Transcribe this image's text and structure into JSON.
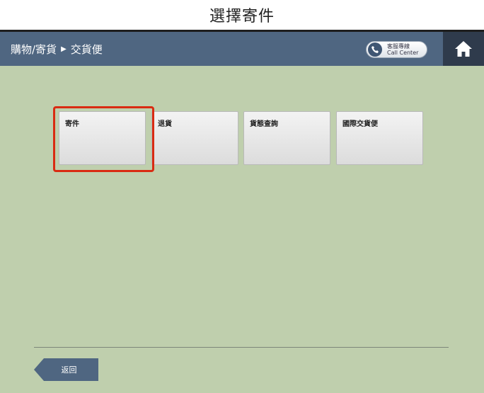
{
  "caption": "選擇寄件",
  "header": {
    "breadcrumb_parent": "購物/寄貨",
    "breadcrumb_current": "交貨便",
    "call_center_zh": "客服專線",
    "call_center_en": "Call Center",
    "home_icon": "home-icon",
    "phone_icon": "phone-icon"
  },
  "tiles": [
    {
      "label": "寄件",
      "selected": true
    },
    {
      "label": "退貨",
      "selected": false
    },
    {
      "label": "貨態查詢",
      "selected": false
    },
    {
      "label": "國際交貨便",
      "selected": false
    }
  ],
  "footer": {
    "back_label": "返回"
  },
  "colors": {
    "header_bg": "#4f6681",
    "screen_bg": "#bfcfad",
    "home_bg": "#2f3b4c",
    "highlight": "#d92b12"
  }
}
